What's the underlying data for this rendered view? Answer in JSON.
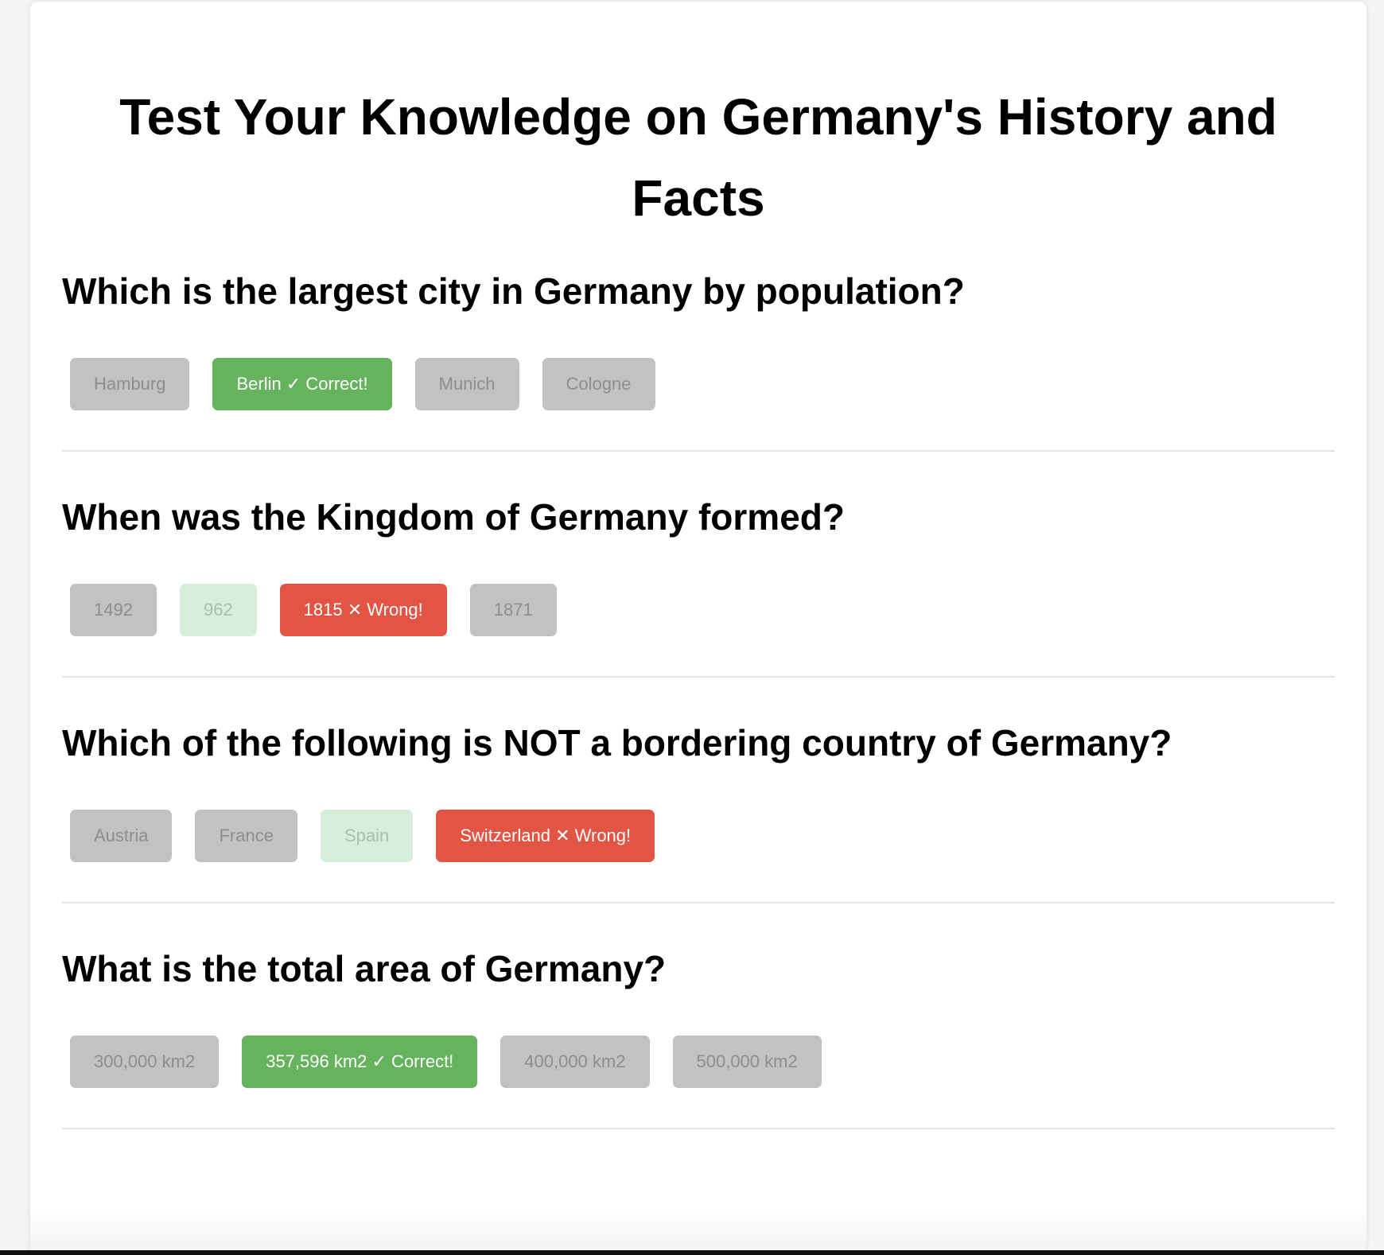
{
  "quiz": {
    "title": "Test Your Knowledge on Germany's History and Facts",
    "questions": [
      {
        "text": "Which is the largest city in Germany by population?",
        "options": [
          {
            "label": "Hamburg",
            "state": "neutral"
          },
          {
            "label": "Berlin ✓ Correct!",
            "state": "correct"
          },
          {
            "label": "Munich",
            "state": "neutral"
          },
          {
            "label": "Cologne",
            "state": "neutral"
          }
        ]
      },
      {
        "text": "When was the Kingdom of Germany formed?",
        "options": [
          {
            "label": "1492",
            "state": "neutral"
          },
          {
            "label": "962",
            "state": "hint"
          },
          {
            "label": "1815 ✕ Wrong!",
            "state": "wrong"
          },
          {
            "label": "1871",
            "state": "neutral"
          }
        ]
      },
      {
        "text": "Which of the following is NOT a bordering country of Germany?",
        "options": [
          {
            "label": "Austria",
            "state": "neutral"
          },
          {
            "label": "France",
            "state": "neutral"
          },
          {
            "label": "Spain",
            "state": "hint"
          },
          {
            "label": "Switzerland ✕ Wrong!",
            "state": "wrong"
          }
        ]
      },
      {
        "text": "What is the total area of Germany?",
        "options": [
          {
            "label": "300,000 km2",
            "state": "neutral"
          },
          {
            "label": "357,596 km2 ✓ Correct!",
            "state": "correct"
          },
          {
            "label": "400,000 km2",
            "state": "neutral"
          },
          {
            "label": "500,000 km2",
            "state": "neutral"
          }
        ]
      }
    ]
  },
  "colors": {
    "neutral_bg": "#c2c2c2",
    "hint_bg": "#d8eddb",
    "correct_bg": "#66b35e",
    "wrong_bg": "#e25444"
  }
}
